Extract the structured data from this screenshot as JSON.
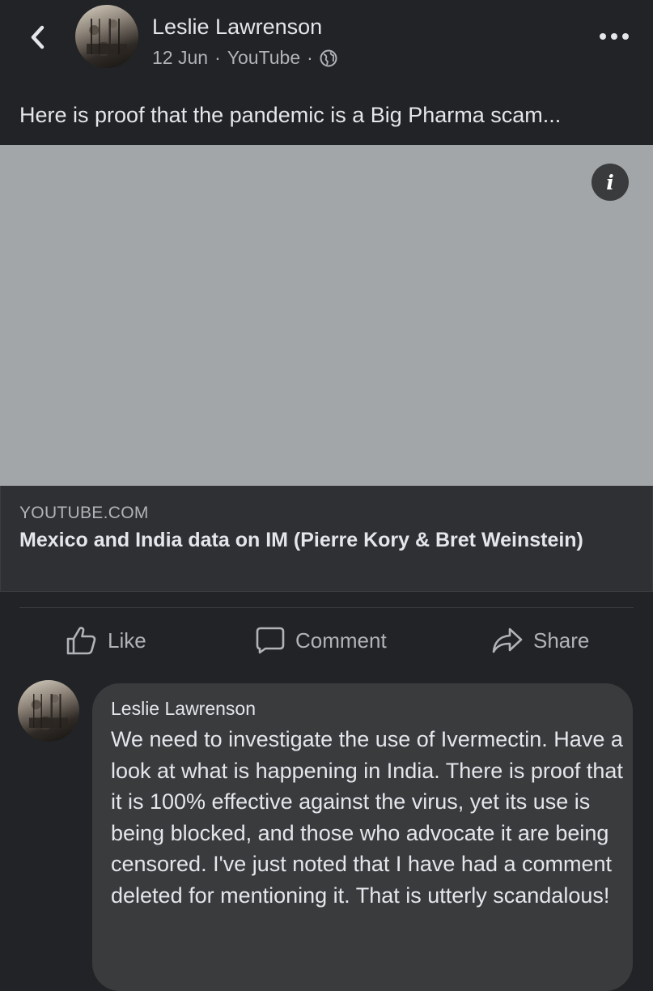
{
  "post": {
    "author": "Leslie Lawrenson",
    "date": "12 Jun",
    "separator": "·",
    "source": "YouTube",
    "audience_icon": "globe-icon",
    "text": "Here is proof that the pandemic is a Big Pharma scam..."
  },
  "link": {
    "domain": "YOUTUBE.COM",
    "title": "Mexico and India data on IM (Pierre Kory & Bret Weinstein)",
    "info_glyph": "i"
  },
  "actions": {
    "like": "Like",
    "comment": "Comment",
    "share": "Share"
  },
  "comment": {
    "author": "Leslie Lawrenson",
    "text": "We need to investigate the use of Ivermectin. Have a look at what is happening in India. There is proof that it is 100% effective against the virus, yet its use is being blocked, and those who advocate it are being censored. I've just noted that I have had a comment deleted for mentioning it. That is utterly scandalous!"
  },
  "colors": {
    "background": "#222326",
    "media_placeholder": "#a3a6a9",
    "bubble": "#3a3b3d",
    "secondary_text": "#b0b3b8"
  }
}
